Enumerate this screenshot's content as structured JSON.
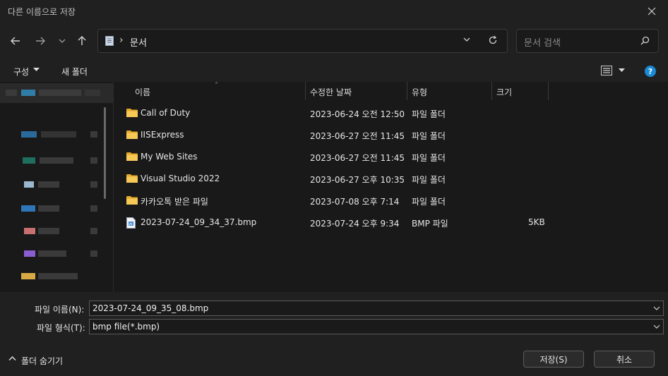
{
  "window": {
    "title": "다른 이름으로 저장"
  },
  "address": {
    "path": "문서",
    "separator": "›"
  },
  "search": {
    "placeholder": "문서 검색"
  },
  "toolbar": {
    "organize": "구성",
    "new_folder": "새 폴더",
    "help": "?"
  },
  "columns": {
    "name": "이름",
    "date": "수정한 날짜",
    "type": "유형",
    "size": "크기"
  },
  "files": [
    {
      "name": "Call of Duty",
      "date": "2023-06-24 오전 12:50",
      "type": "파일 폴더",
      "size": "",
      "icon": "folder-icon"
    },
    {
      "name": "IISExpress",
      "date": "2023-06-27 오전 11:45",
      "type": "파일 폴더",
      "size": "",
      "icon": "folder-icon"
    },
    {
      "name": "My Web Sites",
      "date": "2023-06-27 오전 11:45",
      "type": "파일 폴더",
      "size": "",
      "icon": "folder-icon"
    },
    {
      "name": "Visual Studio 2022",
      "date": "2023-06-27 오후 10:35",
      "type": "파일 폴더",
      "size": "",
      "icon": "folder-icon"
    },
    {
      "name": "카카오톡 받은 파일",
      "date": "2023-07-08 오후 7:14",
      "type": "파일 폴더",
      "size": "",
      "icon": "folder-icon"
    },
    {
      "name": "2023-07-24_09_34_37.bmp",
      "date": "2023-07-24 오후 9:34",
      "type": "BMP 파일",
      "size": "5KB",
      "icon": "bmp-file-icon"
    }
  ],
  "form": {
    "filename_label": "파일 이름(N):",
    "filename_value": "2023-07-24_09_35_08.bmp",
    "filetype_label": "파일 형식(T):",
    "filetype_value": "bmp file(*.bmp)"
  },
  "footer": {
    "hide_folders": "폴더 숨기기",
    "save": "저장(S)",
    "cancel": "취소"
  },
  "colors": {
    "background": "#191919",
    "chrome": "#202020",
    "accent": "#1a8ad4",
    "folder": "#f3c04a"
  }
}
